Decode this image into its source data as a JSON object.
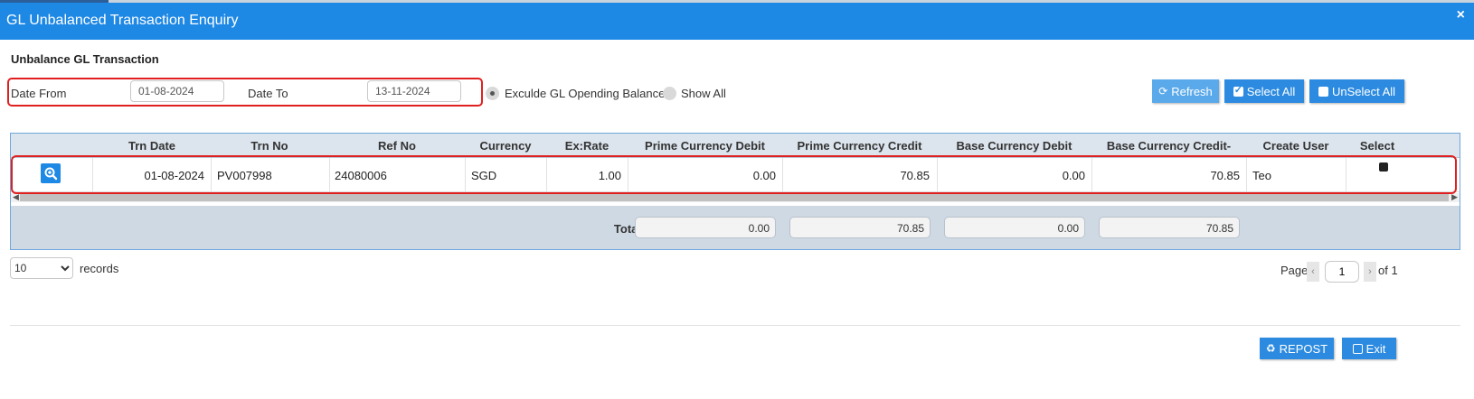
{
  "window": {
    "title": "GL Unbalanced Transaction Enquiry",
    "close": "×"
  },
  "section_title": "Unbalance GL Transaction",
  "filters": {
    "date_from_label": "Date From",
    "date_from_value": "01-08-2024",
    "date_to_label": "Date To",
    "date_to_value": "13-11-2024",
    "radio_exclude_label": "Exculde GL Opending Balance",
    "radio_exclude_selected": true,
    "radio_show_all_label": "Show All"
  },
  "toolbar": {
    "refresh": "Refresh",
    "select_all": "Select All",
    "unselect_all": "UnSelect All"
  },
  "grid": {
    "columns": [
      "Trn Date",
      "Trn No",
      "Ref No",
      "Currency",
      "Ex:Rate",
      "Prime Currency Debit",
      "Prime Currency Credit",
      "Base Currency Debit",
      "Base Currency Credit-",
      "Create User",
      "Select"
    ],
    "rows": [
      {
        "trn_date": "01-08-2024",
        "trn_no": "PV007998",
        "ref_no": "24080006",
        "currency": "SGD",
        "ex_rate": "1.00",
        "prime_debit": "0.00",
        "prime_credit": "70.85",
        "base_debit": "0.00",
        "base_credit": "70.85",
        "create_user": "Teo",
        "selected": true
      }
    ],
    "totals": {
      "label": "Total",
      "prime_debit": "0.00",
      "prime_credit": "70.85",
      "base_debit": "0.00",
      "base_credit": "70.85"
    }
  },
  "pagination": {
    "page_size": "10",
    "page_size_options": [
      "10"
    ],
    "records_label": "records",
    "page_label": "Page",
    "page_value": "1",
    "of_label": "of 1"
  },
  "actions": {
    "repost": "REPOST",
    "exit": "Exit"
  },
  "colors": {
    "titlebar": "#1e88e5",
    "button": "#2c8be0",
    "highlight": "#e02020",
    "grid_header": "#dce4ed",
    "grid_footer": "#cfd9e3"
  }
}
